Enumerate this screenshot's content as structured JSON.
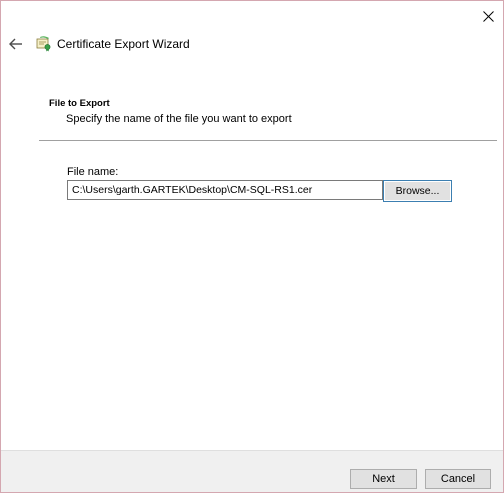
{
  "window": {
    "close_icon": "close-icon"
  },
  "header": {
    "back_icon": "back-arrow-icon",
    "wizard_icon": "certificate-icon",
    "title": "Certificate Export Wizard"
  },
  "section": {
    "title": "File to Export",
    "description": "Specify the name of the file you want to export"
  },
  "form": {
    "file_name_label": "File name:",
    "file_name_value": "C:\\Users\\garth.GARTEK\\Desktop\\CM-SQL-RS1.cer",
    "browse_label": "Browse..."
  },
  "footer": {
    "next_label": "Next",
    "cancel_label": "Cancel"
  },
  "colors": {
    "window_border": "#d4a7b0",
    "focus_border": "#3c7fb1",
    "footer_bg": "#f0f0f0",
    "button_bg": "#e1e1e1"
  }
}
